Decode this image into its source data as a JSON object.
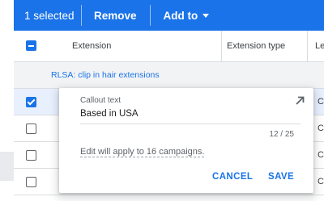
{
  "toolbar": {
    "selected_text": "1 selected",
    "remove_label": "Remove",
    "add_to_label": "Add to"
  },
  "table": {
    "headers": {
      "extension": "Extension",
      "extension_type": "Extension type",
      "level": "Le"
    },
    "group_label": "RLSA: clip in hair extensions",
    "rows": [
      {
        "checked": true,
        "level": "C"
      },
      {
        "checked": false,
        "level": "C"
      },
      {
        "checked": false,
        "level": "C"
      },
      {
        "checked": false,
        "level": "C"
      }
    ]
  },
  "popup": {
    "field_label": "Callout text",
    "field_value": "Based in USA",
    "char_count": "12 / 25",
    "note": "Edit will apply to 16 campaigns.",
    "cancel_label": "CANCEL",
    "save_label": "SAVE",
    "expand_icon": "expand-arrow-icon"
  },
  "colors": {
    "accent": "#1a73e8",
    "selected_row": "#e8f0fe",
    "group_row": "#f1f3f4"
  }
}
